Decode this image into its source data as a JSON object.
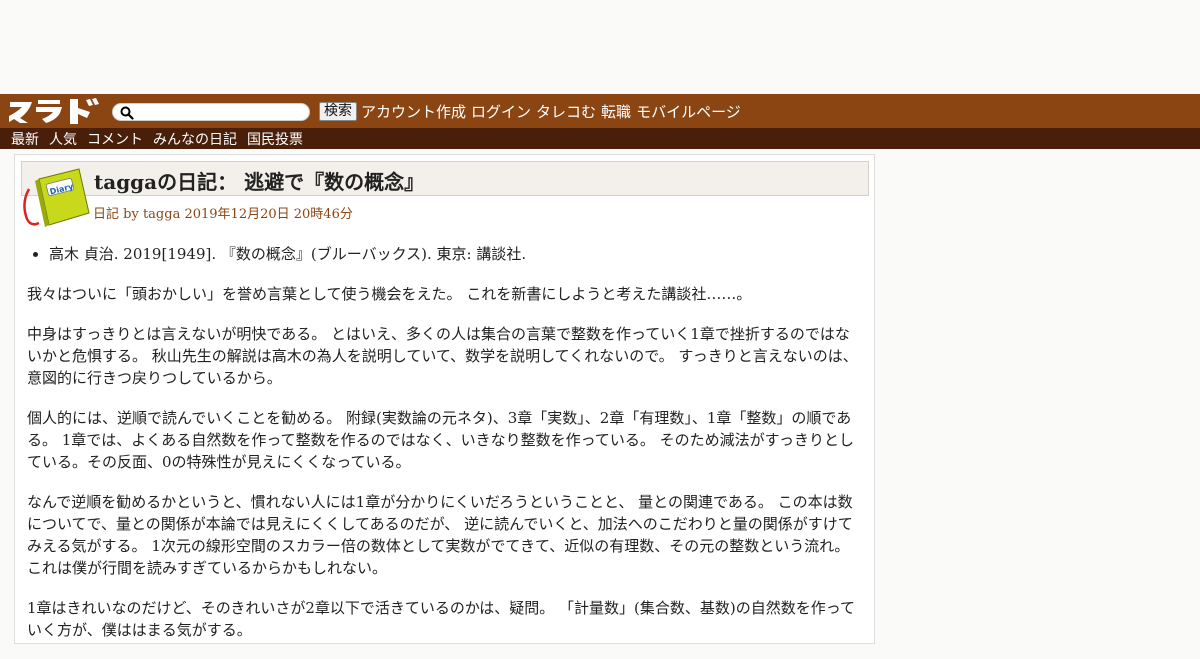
{
  "header": {
    "logo_text": "スラド",
    "search": {
      "value": "",
      "placeholder": ""
    },
    "search_button": "検索",
    "links": [
      "アカウント作成",
      "ログイン",
      "タレコむ",
      "転職",
      "モバイルページ"
    ]
  },
  "subnav": {
    "items": [
      "最新",
      "人気",
      "コメント",
      "みんなの日記",
      "国民投票"
    ]
  },
  "article": {
    "title": "taggaの日記： 逃避で『数の概念』",
    "icon_label": "Diary",
    "meta": {
      "category": "日記",
      "by": " by ",
      "author": "tagga",
      "date": " 2019年12月20日 20時46分"
    },
    "bullets": [
      "高木 貞治. 2019[1949]. 『数の概念』(ブルーバックス). 東京: 講談社."
    ],
    "paragraphs": [
      "我々はついに「頭おかしい」を誉め言葉として使う機会をえた。 これを新書にしようと考えた講談社……。",
      "中身はすっきりとは言えないが明快である。 とはいえ、多くの人は集合の言葉で整数を作っていく1章で挫折するのではないかと危惧する。 秋山先生の解説は高木の為人を説明していて、数学を説明してくれないので。 すっきりと言えないのは、意図的に行きつ戻りつしているから。",
      "個人的には、逆順で読んでいくことを勧める。 附録(実数論の元ネタ)、3章「実数」、2章「有理数」、1章「整数」の順である。 1章では、よくある自然数を作って整数を作るのではなく、いきなり整数を作っている。 そのため減法がすっきりとしている。その反面、0の特殊性が見えにくくなっている。",
      "なんで逆順を勧めるかというと、慣れない人には1章が分かりにくいだろうということと、 量との関連である。 この本は数についてで、量との関係が本論では見えにくくしてあるのだが、 逆に読んでいくと、加法へのこだわりと量の関係がすけてみえる気がする。 1次元の線形空間のスカラー倍の数体として実数がでてきて、近似の有理数、その元の整数という流れ。 これは僕が行間を読みすぎているからかもしれない。",
      "1章はきれいなのだけど、そのきれいさが2章以下で活きているのかは、疑問。 「計量数」(集合数、基数)の自然数を作っていく方が、僕ははまる気がする。"
    ]
  },
  "colors": {
    "topbar": "#8b4513",
    "subbar": "#4a1f0a",
    "meta_link": "#8b4513",
    "title_bg": "#f3efea"
  }
}
